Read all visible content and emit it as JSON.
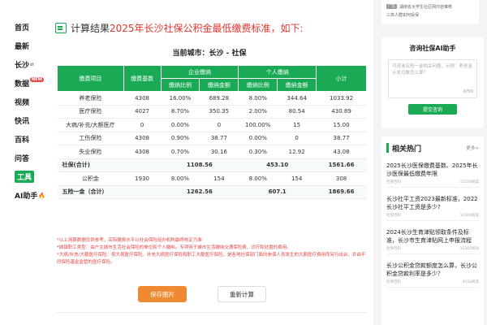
{
  "sidebar": {
    "items": [
      {
        "label": "首页"
      },
      {
        "label": "最新"
      },
      {
        "label": "长沙",
        "suffix": "⇄"
      },
      {
        "label": "数据",
        "badge": "NEW"
      },
      {
        "label": "视频"
      },
      {
        "label": "快讯"
      },
      {
        "label": "百科"
      },
      {
        "label": "问答"
      },
      {
        "label": "工具",
        "active": true
      },
      {
        "label": "AI助手",
        "fire": "🔥"
      }
    ]
  },
  "result": {
    "prefix": "计算结果",
    "highlight": "2025年长沙社保公积金最低缴费标准，如下:",
    "city_line": "当前城市：长沙 - 社保"
  },
  "table": {
    "headers": {
      "item": "缴费项目",
      "base": "缴费基数",
      "employer": "企业缴纳",
      "personal": "个人缴纳",
      "subtotal": "小计",
      "ratio": "缴纳比例",
      "amount": "缴纳金额"
    },
    "rows": [
      [
        "养老保险",
        "4308",
        "16.00%",
        "689.28",
        "8.00%",
        "344.64",
        "1033.92"
      ],
      [
        "医疗保险",
        "4027",
        "8.70%",
        "350.35",
        "2.00%",
        "80.54",
        "430.89"
      ],
      [
        "大病/补充/大额医疗",
        "0",
        "0.00%",
        "0",
        "100.00%",
        "15",
        "15.00"
      ],
      [
        "工伤保险",
        "4308",
        "0.90%",
        "38.77",
        "0.00%",
        "0",
        "38.77"
      ],
      [
        "失业保险",
        "4308",
        "0.70%",
        "30.16",
        "0.30%",
        "12.92",
        "43.08"
      ]
    ],
    "social_total": {
      "label": "社保(合计)",
      "employer": "1108.56",
      "personal": "453.10",
      "subtotal": "1561.66"
    },
    "fund_row": [
      "公积金",
      "1930",
      "8.00%",
      "154",
      "8.00%",
      "154",
      "308"
    ],
    "grand_total": {
      "label": "五险一金（合计）",
      "employer": "1262.56",
      "personal": "607.1",
      "subtotal": "1869.66"
    }
  },
  "notes": [
    "*以上测算数据仅供参考，实际缴费水平以社会保险经办机构最终核定为准",
    "*城镇职工类型：由户主城市生活社会保险的单位和个人缴纳。专项用于城市生活缴纳交通保险费、诊疗和处置的费用。",
    "*大病/补充/大额医疗保险：按大病医疗保险、补充大病医疗保险和职工大额医疗保险，是各地社保部门面向参保人员发生的大额医疗费用而另行出台，并由不同保险基金监管的医疗保险。"
  ],
  "buttons": {
    "save": "保存图片",
    "reset": "重新计算"
  },
  "right": {
    "ad_lines": [
      "湖南省大学生社区网内容推荐",
      "三高人群如何投保"
    ],
    "ad_tag": "广告",
    "ai_title": "咨询社保AI助手",
    "ai_placeholder": "可咨询五险一金相关问题，示例：养老金计发月数怎么算？",
    "ai_count": "0/50",
    "ai_submit": "提交咨询",
    "hot_title": "相关热门",
    "hot_more": "更多>",
    "hot_items": [
      {
        "title": "2025长沙医保缴费基数、2025年长沙医保最低缴费年限",
        "source": "社保百科",
        "views": "11574阅读"
      },
      {
        "title": "长沙社平工资2023最新标准，2022长沙社平工资是多少?",
        "source": "社保百科",
        "views": "11200阅读"
      },
      {
        "title": "2024长沙生育津贴领取条件及标准，长沙市生育津贴网上申报流程",
        "source": "社保百科",
        "views": "11205阅读"
      },
      {
        "title": "长沙公积金贷款额度怎么算，长沙公积金贷款利率是多少？",
        "source": "社保百科",
        "views": "4550阅读"
      }
    ]
  },
  "colors": {
    "brand_green": "#1aaa55",
    "accent_red": "#e0352b",
    "button_orange": "#f08a32"
  }
}
